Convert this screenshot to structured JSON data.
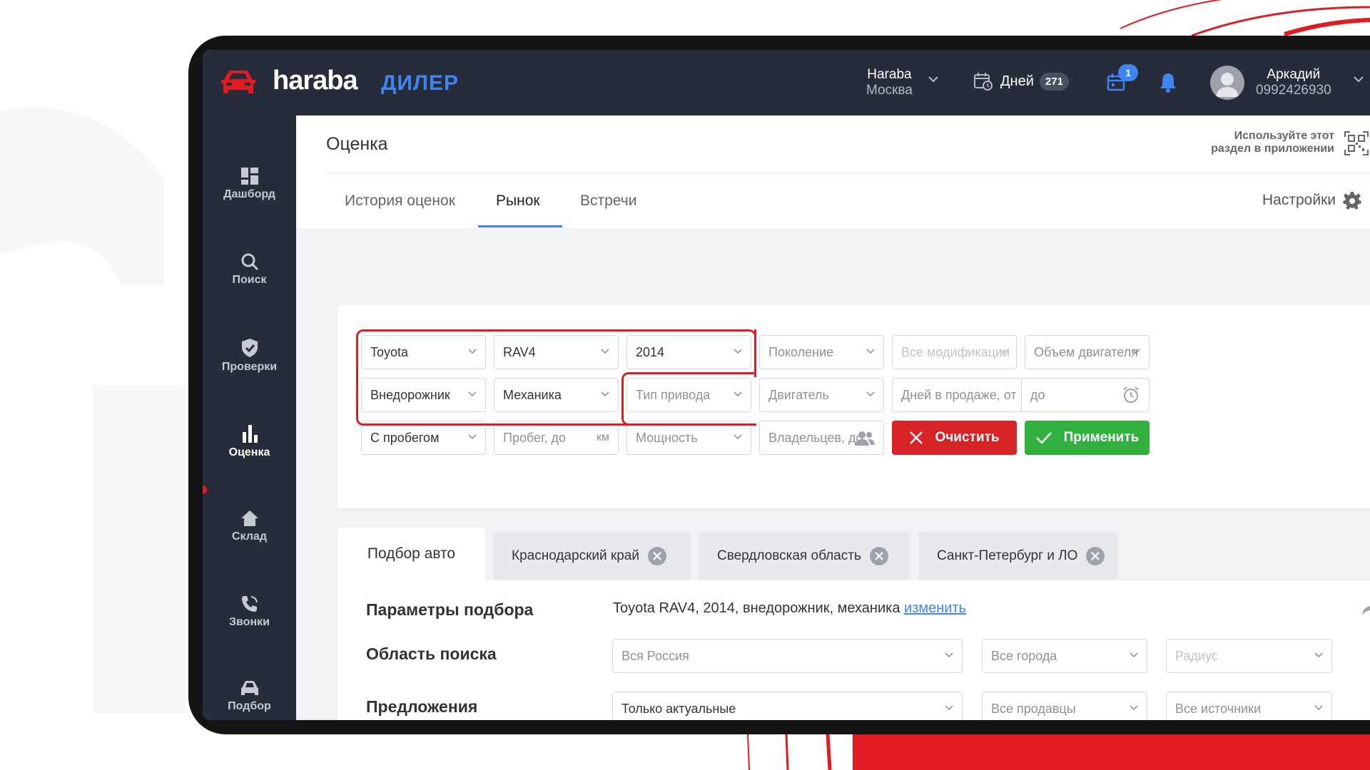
{
  "brand": {
    "name": "haraba",
    "product": "ДИЛЕР",
    "accent": "#3d86f2",
    "red": "#e11b22"
  },
  "header": {
    "company_name": "Haraba",
    "company_city": "Москва",
    "days_label": "Дней",
    "days_count": "271",
    "cart_badge": "1",
    "user_name": "Аркадий",
    "user_phone": "0992426930"
  },
  "sidebar": {
    "items": [
      {
        "label": "Дашборд",
        "icon": "dashboard-icon"
      },
      {
        "label": "Поиск",
        "icon": "search-icon"
      },
      {
        "label": "Проверки",
        "icon": "shield-check-icon"
      },
      {
        "label": "Оценка",
        "icon": "bar-chart-icon",
        "active": true
      },
      {
        "label": "Склад",
        "icon": "home-icon"
      },
      {
        "label": "Звонки",
        "icon": "phone-icon"
      },
      {
        "label": "Подбор",
        "icon": "car-icon"
      }
    ]
  },
  "page": {
    "title": "Оценка",
    "app_hint_line1": "Используйте этот",
    "app_hint_line2": "раздел в приложении",
    "tabs": [
      "История оценок",
      "Рынок",
      "Встречи"
    ],
    "active_tab": "Рынок",
    "settings_label": "Настройки"
  },
  "filters": {
    "make": "Toyota",
    "model": "RAV4",
    "year": "2014",
    "generation_placeholder": "Поколение",
    "modifications_placeholder": "Все модификации",
    "engine_volume_placeholder": "Объем двигателя",
    "body": "Внедорожник",
    "transmission": "Механика",
    "drive_placeholder": "Тип привода",
    "engine_placeholder": "Двигатель",
    "days_from_placeholder": "Дней в продаже, от",
    "days_to_placeholder": "до",
    "mileage_type": "С пробегом",
    "mileage_placeholder": "Пробег, до",
    "mileage_unit": "км",
    "power_placeholder": "Мощность",
    "owners_placeholder": "Владельцев, до",
    "clear_label": "Очистить",
    "apply_label": "Применить"
  },
  "results_tabs": [
    {
      "label": "Подбор авто",
      "active": true
    },
    {
      "label": "Краснодарский край",
      "closable": true
    },
    {
      "label": "Свердловская область",
      "closable": true
    },
    {
      "label": "Санкт-Петербург и ЛО",
      "closable": true
    }
  ],
  "params": {
    "params_label": "Параметры подбора",
    "params_value": "Toyota RAV4, 2014, внедорожник, механика",
    "change_link": "изменить",
    "area_label": "Область поиска",
    "region": "Вся Россия",
    "cities": "Все города",
    "radius_placeholder": "Радиус",
    "offers_label": "Предложения",
    "offers": "Только актуальные",
    "sellers": "Все продавцы",
    "sources": "Все источники"
  }
}
